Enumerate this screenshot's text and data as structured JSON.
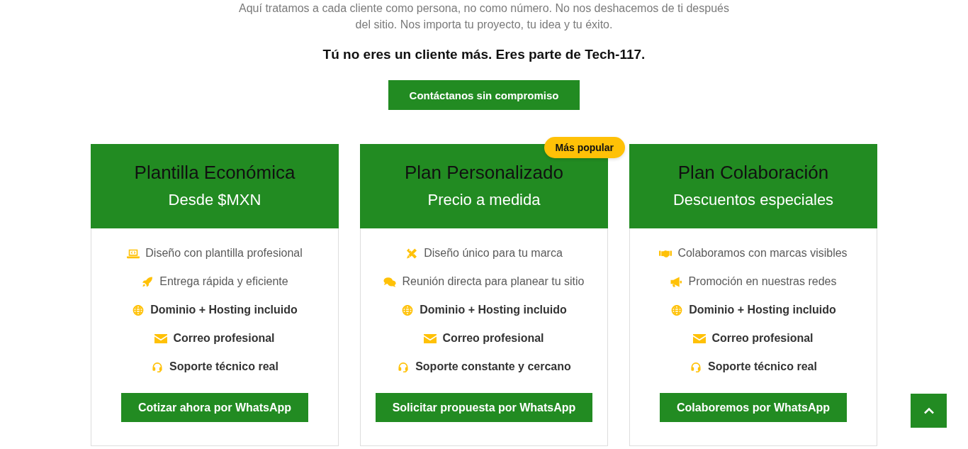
{
  "intro": {
    "paragraph": "Aquí tratamos a cada cliente como persona, no como número. No nos deshacemos de ti después del sitio. Nos importa tu proyecto, tu idea y tu éxito.",
    "tagline": "Tú no eres un cliente más. Eres parte de Tech-117.",
    "button": "Contáctanos sin compromiso"
  },
  "plans": [
    {
      "title": "Plantilla Económica",
      "subtitle": "Desde $MXN",
      "features": [
        {
          "text": "Diseño con plantilla profesional",
          "emphasized": false
        },
        {
          "text": "Entrega rápida y eficiente",
          "emphasized": false
        },
        {
          "text": "Dominio + Hosting incluido",
          "emphasized": true
        },
        {
          "text": "Correo profesional",
          "emphasized": true
        },
        {
          "text": "Soporte técnico real",
          "emphasized": true
        }
      ],
      "button": "Cotizar ahora por WhatsApp"
    },
    {
      "title": "Plan Personalizado",
      "subtitle": "Precio a medida",
      "badge": "Más popular",
      "features": [
        {
          "text": "Diseño único para tu marca",
          "emphasized": false
        },
        {
          "text": "Reunión directa para planear tu sitio",
          "emphasized": false
        },
        {
          "text": "Dominio + Hosting incluido",
          "emphasized": true
        },
        {
          "text": "Correo profesional",
          "emphasized": true
        },
        {
          "text": "Soporte constante y cercano",
          "emphasized": true
        }
      ],
      "button": "Solicitar propuesta por WhatsApp"
    },
    {
      "title": "Plan Colaboración",
      "subtitle": "Descuentos especiales",
      "features": [
        {
          "text": "Colaboramos con marcas visibles",
          "emphasized": false
        },
        {
          "text": "Promoción en nuestras redes",
          "emphasized": false
        },
        {
          "text": "Dominio + Hosting incluido",
          "emphasized": true
        },
        {
          "text": "Correo profesional",
          "emphasized": true
        },
        {
          "text": "Soporte técnico real",
          "emphasized": true
        }
      ],
      "button": "Colaboremos por WhatsApp"
    }
  ]
}
